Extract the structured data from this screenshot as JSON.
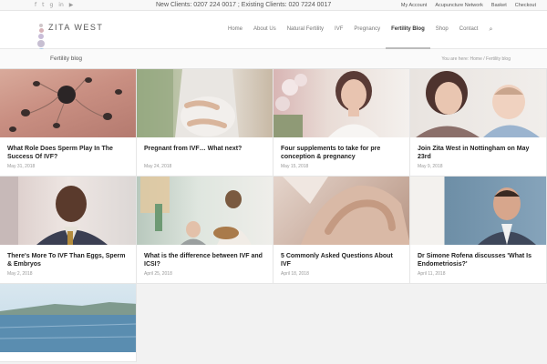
{
  "topbar": {
    "social": [
      "f",
      "t",
      "g",
      "in",
      "▶"
    ],
    "phones": "New Clients: 0207 224 0017 ;   Existing Clients: 020 7224 0017",
    "links": [
      "My Account",
      "Acupuncture Network",
      "Basket",
      "Checkout"
    ]
  },
  "header": {
    "brand": "ZITA WEST",
    "nav": [
      "Home",
      "About Us",
      "Natural Fertility",
      "IVF",
      "Pregnancy",
      "Fertility Blog",
      "Shop",
      "Contact"
    ],
    "active_nav": "Fertility Blog",
    "search_icon": "search-icon"
  },
  "breadcrumb": {
    "page_title": "Fertility blog",
    "trail": "You are here:  Home  /  Fertility blog"
  },
  "posts": [
    {
      "title": "What Role Does Sperm Play In The Success Of IVF?",
      "date": "May 31, 2018"
    },
    {
      "title": "Pregnant from IVF… What next?",
      "date": "May 24, 2018"
    },
    {
      "title": "Four supplements to take for pre conception & pregnancy",
      "date": "May 15, 2018"
    },
    {
      "title": "Join Zita West in Nottingham on May 23rd",
      "date": "May 9, 2018"
    },
    {
      "title": "There's More To IVF Than Eggs, Sperm & Embryos",
      "date": "May 2, 2018"
    },
    {
      "title": "What is the difference between IVF and ICSI?",
      "date": "April 25, 2018"
    },
    {
      "title": "5 Commonly Asked Questions About IVF",
      "date": "April 18, 2018"
    },
    {
      "title": "Dr Simone Rofena discusses 'What Is Endometriosis?'",
      "date": "April 11, 2018"
    },
    {
      "title": "",
      "date": ""
    }
  ],
  "colors": {
    "logo_dots": [
      "#cfc6c9",
      "#d7b2b8",
      "#c9bdd8",
      "#a9c7e6"
    ],
    "active_underline": "#bbbbbb"
  }
}
